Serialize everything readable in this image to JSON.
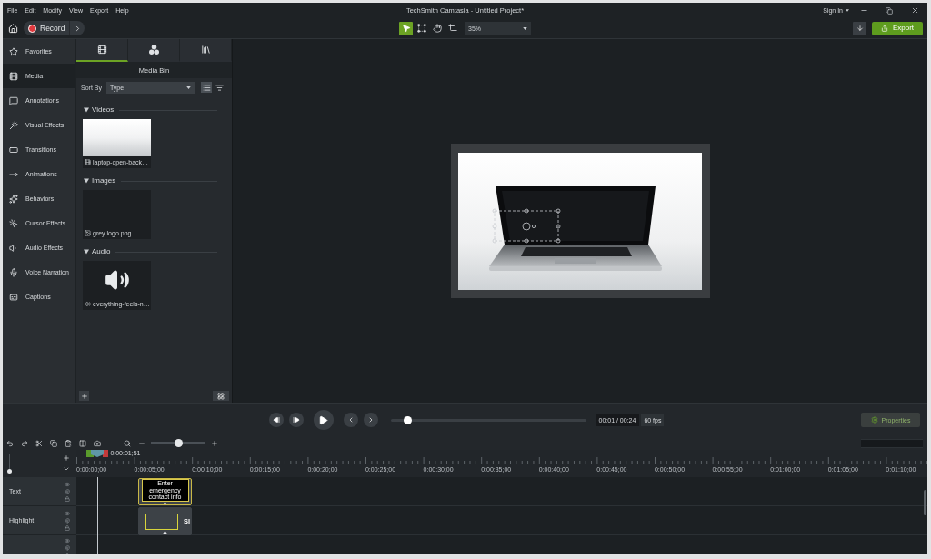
{
  "window": {
    "title": "TechSmith Camtasia - Untitled Project*",
    "account": "Sign In"
  },
  "menu_bar": [
    "File",
    "Edit",
    "Modify",
    "View",
    "Export",
    "Help"
  ],
  "toolbar": {
    "record": "Record",
    "tools": [
      {
        "selected": true
      },
      {
        "selected": false
      },
      {
        "selected": false
      },
      {
        "selected": false
      }
    ],
    "zoom": "35%",
    "export": "Export"
  },
  "sidebar": {
    "items": [
      {
        "label": "Favorites",
        "selected": false
      },
      {
        "label": "Media",
        "selected": true
      },
      {
        "label": "Annotations",
        "selected": false
      },
      {
        "label": "Visual Effects",
        "selected": false
      },
      {
        "label": "Transitions",
        "selected": false
      },
      {
        "label": "Animations",
        "selected": false
      },
      {
        "label": "Behaviors",
        "selected": false
      },
      {
        "label": "Cursor Effects",
        "selected": false
      },
      {
        "label": "Audio Effects",
        "selected": false
      },
      {
        "label": "Voice Narration",
        "selected": false
      },
      {
        "label": "Captions",
        "selected": false
      }
    ]
  },
  "media_bin": {
    "tabs": [
      {
        "selected": true
      },
      {
        "selected": false
      },
      {
        "selected": false
      }
    ],
    "title": "Media Bin",
    "sort_by": {
      "label": "Sort By",
      "value": "Type"
    },
    "sort_buttons": [
      {
        "selected": true
      },
      {
        "selected": false
      }
    ],
    "sections": [
      {
        "title": "Videos",
        "expanded": true,
        "items": [
          {
            "kind": "video",
            "name": "laptop-open-back…"
          }
        ]
      },
      {
        "title": "Images",
        "expanded": true,
        "items": [
          {
            "kind": "image",
            "name": "grey logo.png"
          }
        ]
      },
      {
        "title": "Audio",
        "expanded": true,
        "items": [
          {
            "kind": "audio",
            "name": "everything-feels-n…"
          }
        ]
      }
    ]
  },
  "preview": {
    "object_selected": true
  },
  "playback": {
    "level": 0.09,
    "time": "00:01 / 00:24",
    "fps": "60 fps",
    "properties": "Properties"
  },
  "timeline": {
    "zoom": {
      "level": 0.5
    },
    "track_height": {
      "level": 0.1
    },
    "playhead": {
      "time": "0:00:01;51",
      "level": 0.025
    },
    "ruler": [
      "0:00:00;00",
      "0:00:05;00",
      "0:00:10;00",
      "0:00:15;00",
      "0:00:20;00",
      "0:00:25;00",
      "0:00:30;00",
      "0:00:35;00",
      "0:00:40;00",
      "0:00:45;00",
      "0:00:50;00",
      "0:00:55;00",
      "0:01:00;00",
      "0:01:05;00",
      "0:01:10;00"
    ],
    "tracks": [
      {
        "name": "Text",
        "clips": [
          {
            "kind": "callout",
            "selected": true,
            "text": "Enter emergency contact info"
          }
        ]
      },
      {
        "name": "Highlight",
        "clips": [
          {
            "kind": "highlight",
            "selected": false,
            "text": "Sl"
          }
        ]
      }
    ]
  }
}
